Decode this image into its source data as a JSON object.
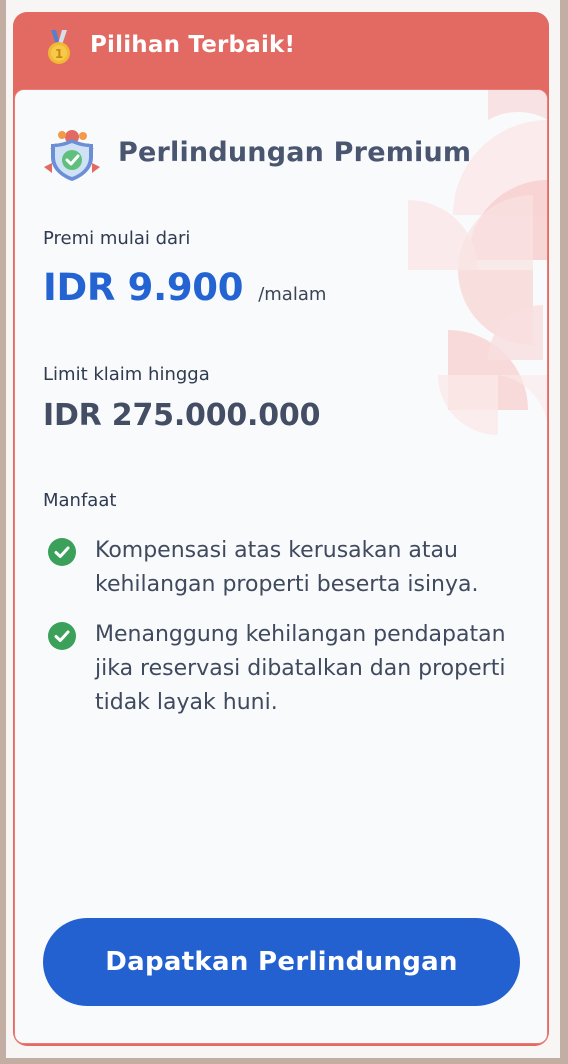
{
  "banner": {
    "text": "Pilihan Terbaik!",
    "icon": "medal-icon"
  },
  "plan": {
    "title": "Perlindungan Premium",
    "icon": "shield-check-icon"
  },
  "premium": {
    "label": "Premi mulai dari",
    "value": "IDR 9.900",
    "unit": "/malam"
  },
  "limit": {
    "label": "Limit klaim hingga",
    "value": "IDR 275.000.000"
  },
  "benefits": {
    "label": "Manfaat",
    "items": [
      "Kompensasi atas kerusakan atau kehilangan properti beserta isinya.",
      "Menanggung kehilangan pendapatan jika reservasi dibatalkan dan properti tidak layak huni."
    ]
  },
  "cta": {
    "label": "Dapatkan Perlindungan"
  },
  "colors": {
    "banner": "#e26a62",
    "accent": "#2364d2",
    "button": "#2360d0",
    "check": "#3aa05a"
  }
}
